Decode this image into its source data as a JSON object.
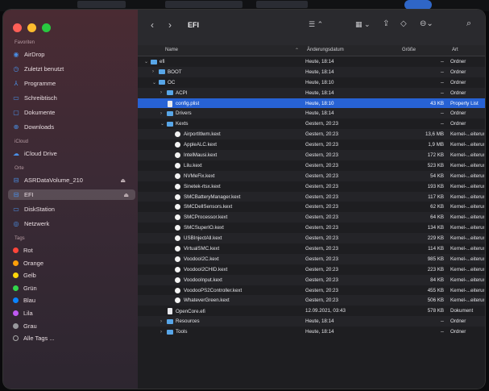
{
  "colors": {
    "selected_row": "#2762d4",
    "folder": "#58a6e8",
    "sidebar_accent": "#4a90e8"
  },
  "toolbar": {
    "title": "EFI",
    "back_icon": "chevron-left-icon",
    "forward_icon": "chevron-right-icon",
    "view_icon": "list-view-icon",
    "group_icon": "grid-view-icon",
    "share_icon": "share-icon",
    "tag_icon": "tag-icon",
    "action_icon": "more-icon",
    "search_icon": "search-icon"
  },
  "columns": {
    "name": "Name",
    "date": "Änderungsdatum",
    "size": "Größe",
    "kind": "Art"
  },
  "sidebar": {
    "favorites_header": "Favoriten",
    "favorites": [
      {
        "label": "AirDrop",
        "icon": "airdrop-icon"
      },
      {
        "label": "Zuletzt benutzt",
        "icon": "clock-icon"
      },
      {
        "label": "Programme",
        "icon": "apps-icon"
      },
      {
        "label": "Schreibtisch",
        "icon": "desktop-icon"
      },
      {
        "label": "Dokumente",
        "icon": "document-icon"
      },
      {
        "label": "Downloads",
        "icon": "download-icon"
      }
    ],
    "icloud_header": "iCloud",
    "icloud": [
      {
        "label": "iCloud Drive",
        "icon": "cloud-icon"
      }
    ],
    "locations_header": "Orte",
    "locations": [
      {
        "label": "ASRDataVolume_210",
        "icon": "disk-icon"
      },
      {
        "label": "EFI",
        "icon": "disk-icon"
      },
      {
        "label": "DiskStation",
        "icon": "display-icon"
      },
      {
        "label": "Netzwerk",
        "icon": "network-icon"
      }
    ],
    "tags_header": "Tags",
    "tags": [
      {
        "label": "Rot",
        "color": "#ff453a"
      },
      {
        "label": "Orange",
        "color": "#ff9f0a"
      },
      {
        "label": "Gelb",
        "color": "#ffd60a"
      },
      {
        "label": "Grün",
        "color": "#32d74b"
      },
      {
        "label": "Blau",
        "color": "#0a84ff"
      },
      {
        "label": "Lila",
        "color": "#bf5af2"
      },
      {
        "label": "Grau",
        "color": "#98989d"
      },
      {
        "label": "Alle Tags ...",
        "color": ""
      }
    ]
  },
  "files": [
    {
      "name": "efi",
      "type": "folder",
      "depth": 0,
      "disclosure": "⌄",
      "date": "Heute, 18:14",
      "size": "--",
      "kind": "Ordner"
    },
    {
      "name": "BOOT",
      "type": "folder",
      "depth": 1,
      "disclosure": "›",
      "date": "Heute, 18:14",
      "size": "--",
      "kind": "Ordner"
    },
    {
      "name": "OC",
      "type": "folder",
      "depth": 1,
      "disclosure": "⌄",
      "date": "Heute, 18:10",
      "size": "--",
      "kind": "Ordner"
    },
    {
      "name": "ACPI",
      "type": "folder",
      "depth": 2,
      "disclosure": "›",
      "date": "Heute, 18:14",
      "size": "--",
      "kind": "Ordner"
    },
    {
      "name": "config.plist",
      "type": "file",
      "depth": 2,
      "disclosure": "",
      "date": "Heute, 18:10",
      "size": "43 KB",
      "kind": "Property List",
      "selected": true
    },
    {
      "name": "Drivers",
      "type": "folder",
      "depth": 2,
      "disclosure": "›",
      "date": "Heute, 18:14",
      "size": "--",
      "kind": "Ordner"
    },
    {
      "name": "Kexts",
      "type": "folder",
      "depth": 2,
      "disclosure": "⌄",
      "date": "Gestern, 20:23",
      "size": "--",
      "kind": "Ordner"
    },
    {
      "name": "AirportItlwm.kext",
      "type": "kext",
      "depth": 3,
      "disclosure": "",
      "date": "Gestern, 20:23",
      "size": "13,6 MB",
      "kind": "Kernel-...eiterung"
    },
    {
      "name": "AppleALC.kext",
      "type": "kext",
      "depth": 3,
      "disclosure": "",
      "date": "Gestern, 20:23",
      "size": "1,9 MB",
      "kind": "Kernel-...eiterung"
    },
    {
      "name": "IntelMausi.kext",
      "type": "kext",
      "depth": 3,
      "disclosure": "",
      "date": "Gestern, 20:23",
      "size": "172 KB",
      "kind": "Kernel-...eiterung"
    },
    {
      "name": "Lilu.kext",
      "type": "kext",
      "depth": 3,
      "disclosure": "",
      "date": "Gestern, 20:23",
      "size": "523 KB",
      "kind": "Kernel-...eiterung"
    },
    {
      "name": "NVMeFix.kext",
      "type": "kext",
      "depth": 3,
      "disclosure": "",
      "date": "Gestern, 20:23",
      "size": "54 KB",
      "kind": "Kernel-...eiterung"
    },
    {
      "name": "Sinetek-rtsx.kext",
      "type": "kext",
      "depth": 3,
      "disclosure": "",
      "date": "Gestern, 20:23",
      "size": "193 KB",
      "kind": "Kernel-...eiterung"
    },
    {
      "name": "SMCBatteryManager.kext",
      "type": "kext",
      "depth": 3,
      "disclosure": "",
      "date": "Gestern, 20:23",
      "size": "117 KB",
      "kind": "Kernel-...eiterung"
    },
    {
      "name": "SMCDellSensors.kext",
      "type": "kext",
      "depth": 3,
      "disclosure": "",
      "date": "Gestern, 20:23",
      "size": "62 KB",
      "kind": "Kernel-...eiterung"
    },
    {
      "name": "SMCProcessor.kext",
      "type": "kext",
      "depth": 3,
      "disclosure": "",
      "date": "Gestern, 20:23",
      "size": "64 KB",
      "kind": "Kernel-...eiterung"
    },
    {
      "name": "SMCSuperIO.kext",
      "type": "kext",
      "depth": 3,
      "disclosure": "",
      "date": "Gestern, 20:23",
      "size": "134 KB",
      "kind": "Kernel-...eiterung"
    },
    {
      "name": "USBInjectAll.kext",
      "type": "kext",
      "depth": 3,
      "disclosure": "",
      "date": "Gestern, 20:23",
      "size": "229 KB",
      "kind": "Kernel-...eiterung"
    },
    {
      "name": "VirtualSMC.kext",
      "type": "kext",
      "depth": 3,
      "disclosure": "",
      "date": "Gestern, 20:23",
      "size": "114 KB",
      "kind": "Kernel-...eiterung"
    },
    {
      "name": "VoodooI2C.kext",
      "type": "kext",
      "depth": 3,
      "disclosure": "",
      "date": "Gestern, 20:23",
      "size": "985 KB",
      "kind": "Kernel-...eiterung"
    },
    {
      "name": "VoodooI2CHID.kext",
      "type": "kext",
      "depth": 3,
      "disclosure": "",
      "date": "Gestern, 20:23",
      "size": "223 KB",
      "kind": "Kernel-...eiterung"
    },
    {
      "name": "VoodooInput.kext",
      "type": "kext",
      "depth": 3,
      "disclosure": "",
      "date": "Gestern, 20:23",
      "size": "84 KB",
      "kind": "Kernel-...eiterung"
    },
    {
      "name": "VoodooPS2Controller.kext",
      "type": "kext",
      "depth": 3,
      "disclosure": "",
      "date": "Gestern, 20:23",
      "size": "455 KB",
      "kind": "Kernel-...eiterung"
    },
    {
      "name": "WhateverGreen.kext",
      "type": "kext",
      "depth": 3,
      "disclosure": "",
      "date": "Gestern, 20:23",
      "size": "506 KB",
      "kind": "Kernel-...eiterung"
    },
    {
      "name": "OpenCore.efi",
      "type": "file",
      "depth": 2,
      "disclosure": "",
      "date": "12.09.2021, 03:43",
      "size": "578 KB",
      "kind": "Dokument"
    },
    {
      "name": "Resources",
      "type": "folder",
      "depth": 2,
      "disclosure": "›",
      "date": "Heute, 18:14",
      "size": "--",
      "kind": "Ordner"
    },
    {
      "name": "Tools",
      "type": "folder",
      "depth": 2,
      "disclosure": "›",
      "date": "Heute, 18:14",
      "size": "--",
      "kind": "Ordner"
    }
  ]
}
